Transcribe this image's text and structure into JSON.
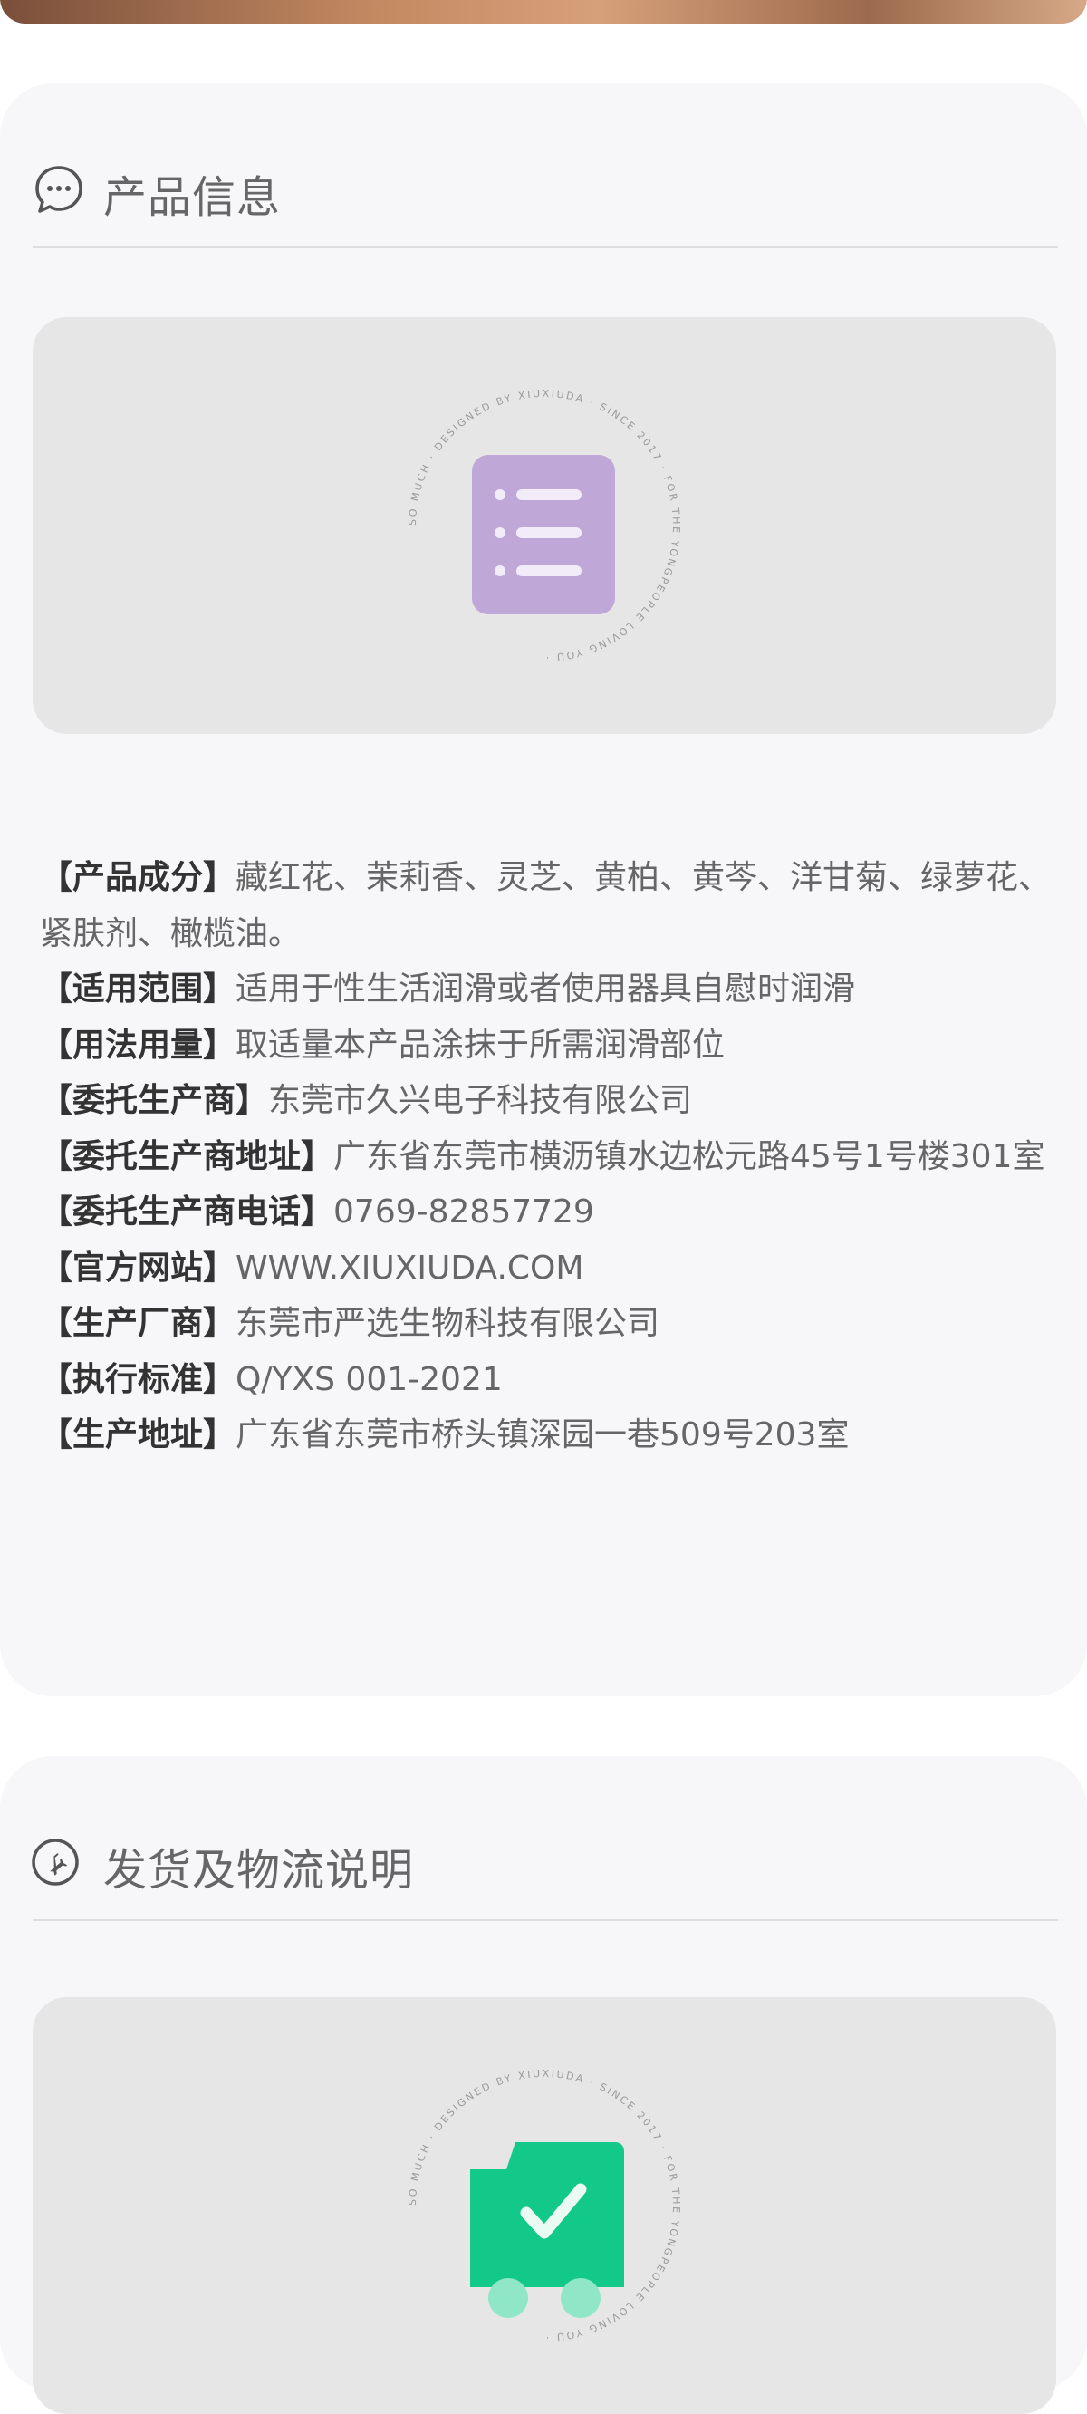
{
  "product_info": {
    "title": "产品信息",
    "ring_text": "SO MUCH · DESIGNED BY XIUXIUDA · SINCE 2017 · FOR THE YONGPEOPLE LOVING YOU · ",
    "rows": [
      {
        "key": "【产品成分】",
        "value": "藏红花、茉莉香、灵芝、黄柏、黄芩、洋甘菊、绿萝花、紧肤剂、橄榄油。"
      },
      {
        "key": "【适用范围】",
        "value": "适用于性生活润滑或者使用器具自慰时润滑"
      },
      {
        "key": "【用法用量】",
        "value": "取适量本产品涂抹于所需润滑部位"
      },
      {
        "key": "【委托生产商】",
        "value": "东莞市久兴电子科技有限公司"
      },
      {
        "key": "【委托生产商地址】",
        "value": "广东省东莞市横沥镇水边松元路45号1号楼301室"
      },
      {
        "key": "【委托生产商电话】",
        "value": "0769-82857729"
      },
      {
        "key": "【官方网站】",
        "value": "WWW.XIUXIUDA.COM"
      },
      {
        "key": "【生产厂商】",
        "value": "东莞市严选生物科技有限公司"
      },
      {
        "key": "【执行标准】",
        "value": "Q/YXS 001-2021"
      },
      {
        "key": "【生产地址】",
        "value": "广东省东莞市桥头镇深园一巷509号203室"
      }
    ]
  },
  "shipping": {
    "title": "发货及物流说明",
    "ring_text": "SO MUCH · DESIGNED BY XIUXIUDA · SINCE 2017 · FOR THE YONGPEOPLE LOVING YOU · "
  },
  "colors": {
    "list_icon": "#bfa7d8",
    "truck_icon": "#12c98a"
  },
  "icons": {
    "product_head": "chat-bubble-icon",
    "shipping_head": "airplane-icon",
    "product_placeholder": "list-icon",
    "shipping_placeholder": "delivery-truck-check-icon"
  }
}
